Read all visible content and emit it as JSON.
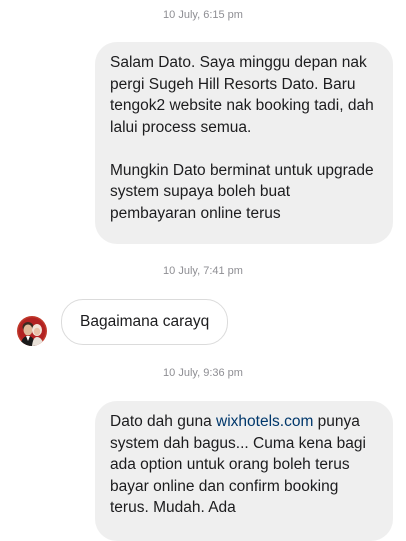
{
  "messages": [
    {
      "timestamp": "10 July, 6:15 pm",
      "sender": "self",
      "paragraphs": [
        "Salam Dato. Saya minggu depan nak pergi Sugeh Hill Resorts Dato. Baru tengok2 website nak booking tadi, dah lalui process semua.",
        "Mungkin Dato berminat untuk upgrade system supaya boleh buat pembayaran online terus"
      ]
    },
    {
      "timestamp": "10 July, 7:41 pm",
      "sender": "contact",
      "text": "Bagaimana carayq",
      "avatar_icon": "profile-avatar"
    },
    {
      "timestamp": "10 July, 9:36 pm",
      "sender": "self",
      "text_before_link": "Dato dah guna ",
      "link_text": "wixhotels.com",
      "text_after_link": " punya system dah bagus... Cuma kena bagi ada option untuk orang boleh terus bayar online dan confirm booking terus. Mudah. Ada"
    }
  ],
  "colors": {
    "outgoing_bubble": "#efefef",
    "incoming_border": "#dbdbdb",
    "timestamp": "#8e8e93",
    "link": "#00376b"
  }
}
